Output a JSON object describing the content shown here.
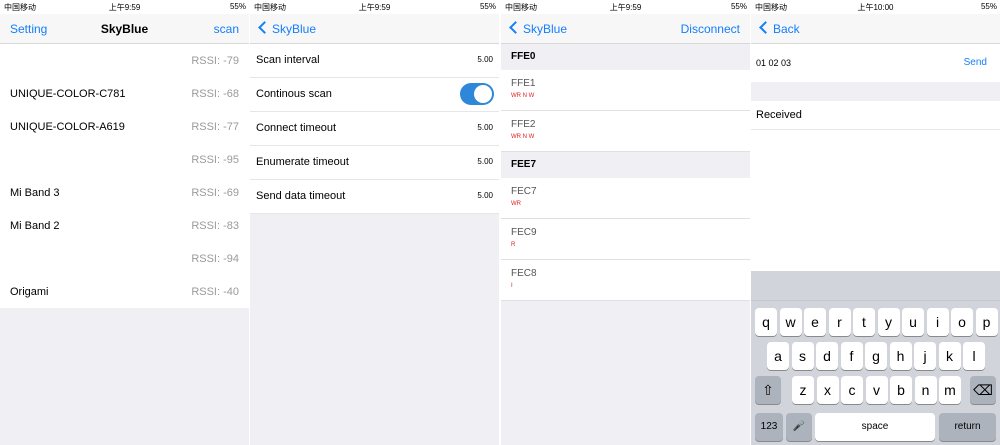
{
  "status": {
    "carrier": "中国移动",
    "right": "55%"
  },
  "screen1": {
    "time": "上午9:59",
    "nav": {
      "left": "Setting",
      "title": "SkyBlue",
      "right": "scan"
    },
    "devices": [
      {
        "name": "",
        "rssi": "RSSI: -79"
      },
      {
        "name": "UNIQUE-COLOR-C781",
        "rssi": "RSSI: -68"
      },
      {
        "name": "UNIQUE-COLOR-A619",
        "rssi": "RSSI: -77"
      },
      {
        "name": "",
        "rssi": "RSSI: -95"
      },
      {
        "name": "Mi Band 3",
        "rssi": "RSSI: -69"
      },
      {
        "name": "Mi Band 2",
        "rssi": "RSSI: -83"
      },
      {
        "name": "",
        "rssi": "RSSI: -94"
      },
      {
        "name": "Origami",
        "rssi": "RSSI: -40"
      }
    ]
  },
  "screen2": {
    "time": "上午9:59",
    "nav": {
      "back": "SkyBlue"
    },
    "settings": [
      {
        "name": "Scan interval",
        "value": "5.00"
      },
      {
        "name": "Continous scan",
        "toggle": true
      },
      {
        "name": "Connect timeout",
        "value": "5.00"
      },
      {
        "name": "Enumerate timeout",
        "value": "5.00"
      },
      {
        "name": "Send data timeout",
        "value": "5.00"
      }
    ]
  },
  "screen3": {
    "time": "上午9:59",
    "nav": {
      "back": "SkyBlue",
      "right": "Disconnect"
    },
    "services": [
      {
        "uuid": "FFE0",
        "characteristics": [
          {
            "name": "FFE1",
            "props": "WR N W"
          },
          {
            "name": "FFE2",
            "props": "WR N W"
          }
        ]
      },
      {
        "uuid": "FEE7",
        "characteristics": [
          {
            "name": "FEC7",
            "props": "WR"
          },
          {
            "name": "FEC9",
            "props": "R"
          },
          {
            "name": "FEC8",
            "props": "I"
          }
        ]
      }
    ]
  },
  "screen4": {
    "time": "上午10:00",
    "nav": {
      "back": "Back"
    },
    "input_value": "01 02 03",
    "send_label": "Send",
    "received_label": "Received",
    "keyboard": {
      "row1": [
        "q",
        "w",
        "e",
        "r",
        "t",
        "y",
        "u",
        "i",
        "o",
        "p"
      ],
      "row2": [
        "a",
        "s",
        "d",
        "f",
        "g",
        "h",
        "j",
        "k",
        "l"
      ],
      "row3": [
        "z",
        "x",
        "c",
        "v",
        "b",
        "n",
        "m"
      ],
      "num_key": "123",
      "space_key": "space",
      "return_key": "return"
    }
  }
}
